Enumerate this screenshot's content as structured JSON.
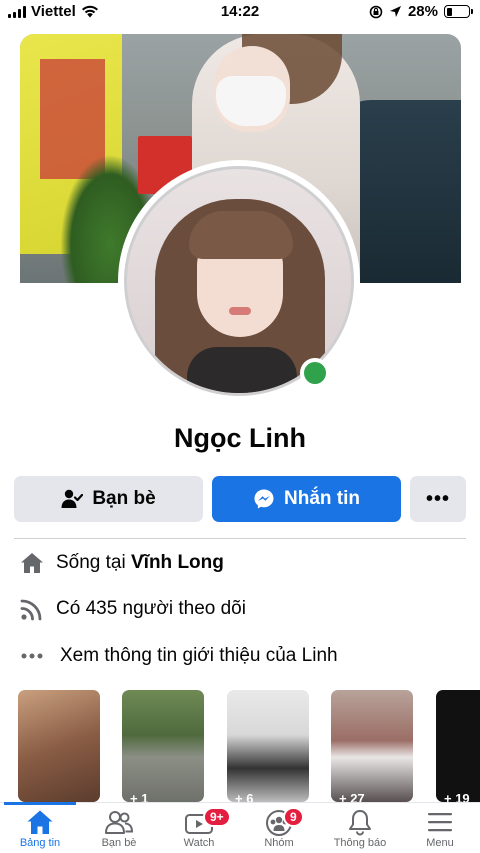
{
  "status_bar": {
    "carrier": "Viettel",
    "time": "14:22",
    "battery_percent": "28%",
    "battery_level": 0.28
  },
  "profile": {
    "name": "Ngọc Linh",
    "online": true,
    "online_color": "#31a24c"
  },
  "actions": {
    "friends_label": "Bạn bè",
    "message_label": "Nhắn tin",
    "more_label": "•••"
  },
  "info": {
    "live_prefix": "Sống tại ",
    "live_place": "Vĩnh Long",
    "followers_text": "Có 435 người theo dõi",
    "about_text": "Xem thông tin giới thiệu của Linh"
  },
  "photos": [
    {
      "count": ""
    },
    {
      "count": "+ 1"
    },
    {
      "count": "+ 6"
    },
    {
      "count": "+ 27"
    },
    {
      "count": "+ 19"
    }
  ],
  "tabs": [
    {
      "label": "Bảng tin",
      "icon": "home-icon",
      "active": true
    },
    {
      "label": "Bạn bè",
      "icon": "friends-icon",
      "active": false
    },
    {
      "label": "Watch",
      "icon": "watch-icon",
      "badge": "9+",
      "active": false
    },
    {
      "label": "Nhóm",
      "icon": "groups-icon",
      "badge": "9",
      "active": false
    },
    {
      "label": "Thông báo",
      "icon": "bell-icon",
      "active": false
    },
    {
      "label": "Menu",
      "icon": "menu-icon",
      "active": false
    }
  ],
  "colors": {
    "accent": "#1b74e4",
    "badge": "#e41e3f",
    "secondary_button": "#e4e6eb"
  }
}
